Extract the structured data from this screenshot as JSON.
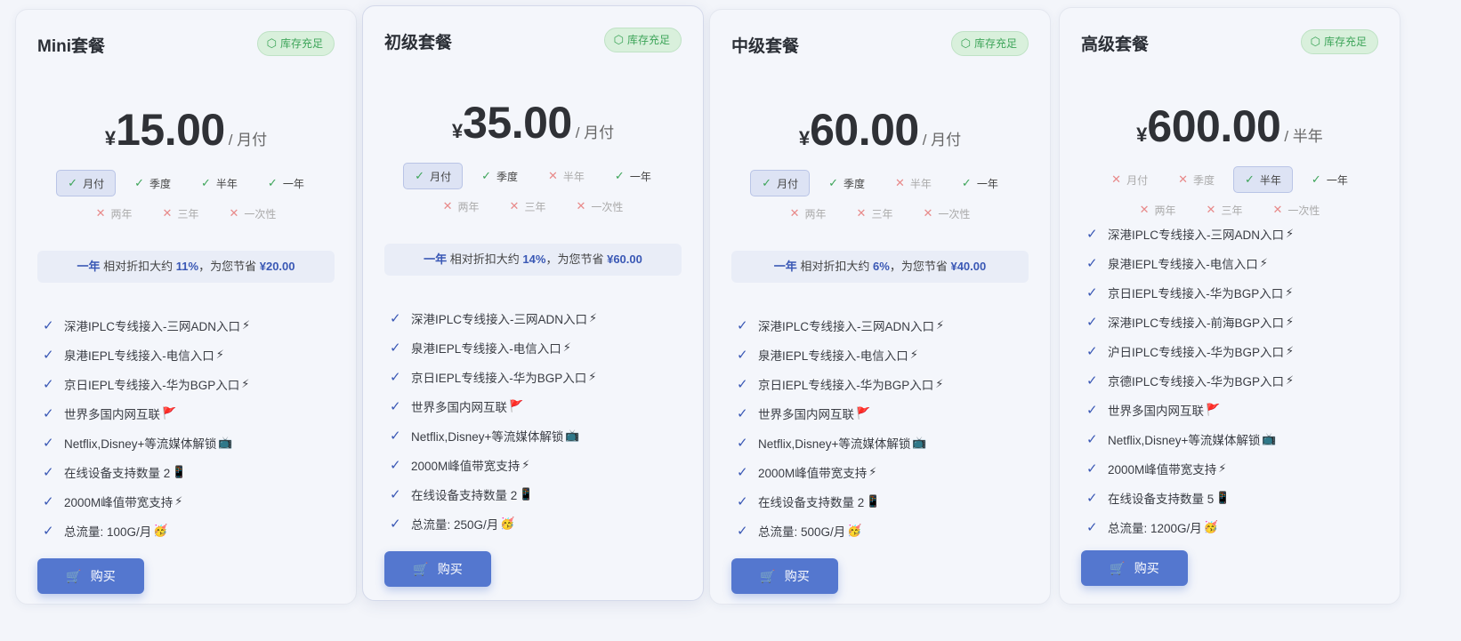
{
  "currency_symbol": "¥",
  "stock_badge_label": "库存充足",
  "buy_label": "购买",
  "plans": [
    {
      "title": "Mini套餐",
      "price": "15.00",
      "period": "/ 月付",
      "periods_row1": [
        {
          "label": "月付",
          "available": true,
          "selected": true
        },
        {
          "label": "季度",
          "available": true,
          "selected": false
        },
        {
          "label": "半年",
          "available": true,
          "selected": false
        },
        {
          "label": "一年",
          "available": true,
          "selected": false
        }
      ],
      "periods_row2": [
        {
          "label": "两年",
          "available": false,
          "selected": false
        },
        {
          "label": "三年",
          "available": false,
          "selected": false
        },
        {
          "label": "一次性",
          "available": false,
          "selected": false
        }
      ],
      "discount": {
        "period": "一年",
        "text1": "相对折扣大约",
        "percent": "11%",
        "text2": "，为您节省",
        "save": "¥20.00"
      },
      "features": [
        {
          "text": "深港IPLC专线接入-三网ADN入口",
          "emoji": "⚡"
        },
        {
          "text": "泉港IEPL专线接入-电信入口",
          "emoji": "⚡"
        },
        {
          "text": "京日IEPL专线接入-华为BGP入口",
          "emoji": "⚡"
        },
        {
          "text": "世界多国内网互联",
          "emoji": "🚩"
        },
        {
          "text": "Netflix,Disney+等流媒体解锁",
          "emoji": "📺"
        },
        {
          "text": "在线设备支持数量 2",
          "emoji": "📱"
        },
        {
          "text": "2000M峰值带宽支持",
          "emoji": "⚡"
        },
        {
          "text": "总流量: 100G/月",
          "emoji": "🥳"
        }
      ]
    },
    {
      "title": "初级套餐",
      "price": "35.00",
      "period": "/ 月付",
      "periods_row1": [
        {
          "label": "月付",
          "available": true,
          "selected": true
        },
        {
          "label": "季度",
          "available": true,
          "selected": false
        },
        {
          "label": "半年",
          "available": false,
          "selected": false
        },
        {
          "label": "一年",
          "available": true,
          "selected": false
        }
      ],
      "periods_row2": [
        {
          "label": "两年",
          "available": false,
          "selected": false
        },
        {
          "label": "三年",
          "available": false,
          "selected": false
        },
        {
          "label": "一次性",
          "available": false,
          "selected": false
        }
      ],
      "discount": {
        "period": "一年",
        "text1": "相对折扣大约",
        "percent": "14%",
        "text2": "，为您节省",
        "save": "¥60.00"
      },
      "features": [
        {
          "text": "深港IPLC专线接入-三网ADN入口",
          "emoji": "⚡"
        },
        {
          "text": "泉港IEPL专线接入-电信入口",
          "emoji": "⚡"
        },
        {
          "text": "京日IEPL专线接入-华为BGP入口",
          "emoji": "⚡"
        },
        {
          "text": "世界多国内网互联",
          "emoji": "🚩"
        },
        {
          "text": "Netflix,Disney+等流媒体解锁",
          "emoji": "📺"
        },
        {
          "text": "2000M峰值带宽支持",
          "emoji": "⚡"
        },
        {
          "text": "在线设备支持数量 2",
          "emoji": "📱"
        },
        {
          "text": "总流量: 250G/月",
          "emoji": "🥳"
        }
      ]
    },
    {
      "title": "中级套餐",
      "price": "60.00",
      "period": "/ 月付",
      "periods_row1": [
        {
          "label": "月付",
          "available": true,
          "selected": true
        },
        {
          "label": "季度",
          "available": true,
          "selected": false
        },
        {
          "label": "半年",
          "available": false,
          "selected": false
        },
        {
          "label": "一年",
          "available": true,
          "selected": false
        }
      ],
      "periods_row2": [
        {
          "label": "两年",
          "available": false,
          "selected": false
        },
        {
          "label": "三年",
          "available": false,
          "selected": false
        },
        {
          "label": "一次性",
          "available": false,
          "selected": false
        }
      ],
      "discount": {
        "period": "一年",
        "text1": "相对折扣大约",
        "percent": "6%",
        "text2": "，为您节省",
        "save": "¥40.00"
      },
      "features": [
        {
          "text": "深港IPLC专线接入-三网ADN入口",
          "emoji": "⚡"
        },
        {
          "text": "泉港IEPL专线接入-电信入口",
          "emoji": "⚡"
        },
        {
          "text": "京日IEPL专线接入-华为BGP入口",
          "emoji": "⚡"
        },
        {
          "text": "世界多国内网互联",
          "emoji": "🚩"
        },
        {
          "text": "Netflix,Disney+等流媒体解锁",
          "emoji": "📺"
        },
        {
          "text": "2000M峰值带宽支持",
          "emoji": "⚡"
        },
        {
          "text": "在线设备支持数量 2",
          "emoji": "📱"
        },
        {
          "text": "总流量: 500G/月",
          "emoji": "🥳"
        }
      ]
    },
    {
      "title": "高级套餐",
      "price": "600.00",
      "period": "/ 半年",
      "periods_row1": [
        {
          "label": "月付",
          "available": false,
          "selected": false
        },
        {
          "label": "季度",
          "available": false,
          "selected": false
        },
        {
          "label": "半年",
          "available": true,
          "selected": true
        },
        {
          "label": "一年",
          "available": true,
          "selected": false
        }
      ],
      "periods_row2": [
        {
          "label": "两年",
          "available": false,
          "selected": false
        },
        {
          "label": "三年",
          "available": false,
          "selected": false
        },
        {
          "label": "一次性",
          "available": false,
          "selected": false
        }
      ],
      "discount": null,
      "features": [
        {
          "text": "深港IPLC专线接入-三网ADN入口",
          "emoji": "⚡"
        },
        {
          "text": "泉港IEPL专线接入-电信入口",
          "emoji": "⚡"
        },
        {
          "text": "京日IEPL专线接入-华为BGP入口",
          "emoji": "⚡"
        },
        {
          "text": "深港IPLC专线接入-前海BGP入口",
          "emoji": "⚡"
        },
        {
          "text": "沪日IPLC专线接入-华为BGP入口",
          "emoji": "⚡"
        },
        {
          "text": "京德IPLC专线接入-华为BGP入口",
          "emoji": "⚡"
        },
        {
          "text": "世界多国内网互联",
          "emoji": "🚩"
        },
        {
          "text": "Netflix,Disney+等流媒体解锁",
          "emoji": "📺"
        },
        {
          "text": "2000M峰值带宽支持",
          "emoji": "⚡"
        },
        {
          "text": "在线设备支持数量 5",
          "emoji": "📱"
        },
        {
          "text": "总流量: 1200G/月",
          "emoji": "🥳"
        }
      ]
    }
  ]
}
